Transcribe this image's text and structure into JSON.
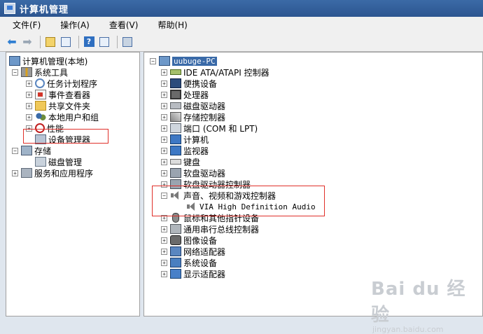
{
  "window": {
    "title": "计算机管理"
  },
  "menu": [
    "文件(F)",
    "操作(A)",
    "查看(V)",
    "帮助(H)"
  ],
  "left_tree": {
    "root": "计算机管理(本地)",
    "system_tools": "系统工具",
    "task_scheduler": "任务计划程序",
    "event_viewer": "事件查看器",
    "shared_folders": "共享文件夹",
    "local_users": "本地用户和组",
    "performance": "性能",
    "device_manager": "设备管理器",
    "storage": "存储",
    "disk_management": "磁盘管理",
    "services_apps": "服务和应用程序"
  },
  "right_tree": {
    "root": "uubuge-PC",
    "categories": [
      "IDE ATA/ATAPI 控制器",
      "便携设备",
      "处理器",
      "磁盘驱动器",
      "存储控制器",
      "端口 (COM 和 LPT)",
      "计算机",
      "监视器",
      "键盘",
      "软盘驱动器",
      "软盘驱动器控制器",
      "声音、视频和游戏控制器",
      "鼠标和其他指针设备",
      "通用串行总线控制器",
      "图像设备",
      "网络适配器",
      "系统设备",
      "显示适配器"
    ],
    "audio_device": "VIA High Definition Audio"
  },
  "watermark": {
    "brand": "Bai du 经验",
    "url": "jingyan.baidu.com"
  },
  "colors": {
    "title_bar": "#2c5590",
    "highlight_box": "#e0302a"
  }
}
